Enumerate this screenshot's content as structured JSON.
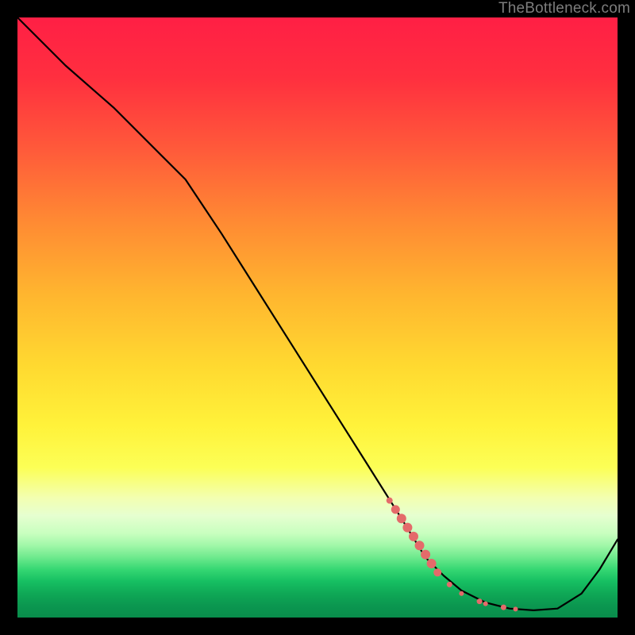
{
  "watermark": "TheBottleneck.com",
  "colors": {
    "curve": "#000000",
    "marker": "#e46a6a"
  },
  "chart_data": {
    "type": "line",
    "title": "",
    "xlabel": "",
    "ylabel": "",
    "xlim": [
      0,
      100
    ],
    "ylim": [
      0,
      100
    ],
    "grid": false,
    "legend": false,
    "series": [
      {
        "name": "curve",
        "x": [
          0,
          8,
          16,
          24,
          28,
          34,
          40,
          46,
          52,
          58,
          64,
          68,
          71,
          74,
          78,
          82,
          86,
          90,
          94,
          97,
          100
        ],
        "y": [
          100,
          92,
          85,
          77,
          73,
          64,
          54.5,
          45,
          35.5,
          26,
          16.5,
          10,
          7,
          4.5,
          2.5,
          1.5,
          1.2,
          1.5,
          4,
          8,
          13
        ]
      }
    ],
    "markers": {
      "name": "segment",
      "points": [
        {
          "x": 62,
          "y": 19.5,
          "r": 4
        },
        {
          "x": 63,
          "y": 18,
          "r": 5.5
        },
        {
          "x": 64,
          "y": 16.5,
          "r": 6
        },
        {
          "x": 65,
          "y": 15,
          "r": 6
        },
        {
          "x": 66,
          "y": 13.5,
          "r": 6
        },
        {
          "x": 67,
          "y": 12,
          "r": 6
        },
        {
          "x": 68,
          "y": 10.5,
          "r": 6
        },
        {
          "x": 69,
          "y": 9,
          "r": 6
        },
        {
          "x": 70,
          "y": 7.5,
          "r": 5
        },
        {
          "x": 72,
          "y": 5.5,
          "r": 3.5
        },
        {
          "x": 74,
          "y": 4,
          "r": 3
        },
        {
          "x": 77,
          "y": 2.7,
          "r": 3.5
        },
        {
          "x": 78,
          "y": 2.3,
          "r": 3
        },
        {
          "x": 81,
          "y": 1.7,
          "r": 3.5
        },
        {
          "x": 83,
          "y": 1.4,
          "r": 3
        }
      ]
    }
  }
}
